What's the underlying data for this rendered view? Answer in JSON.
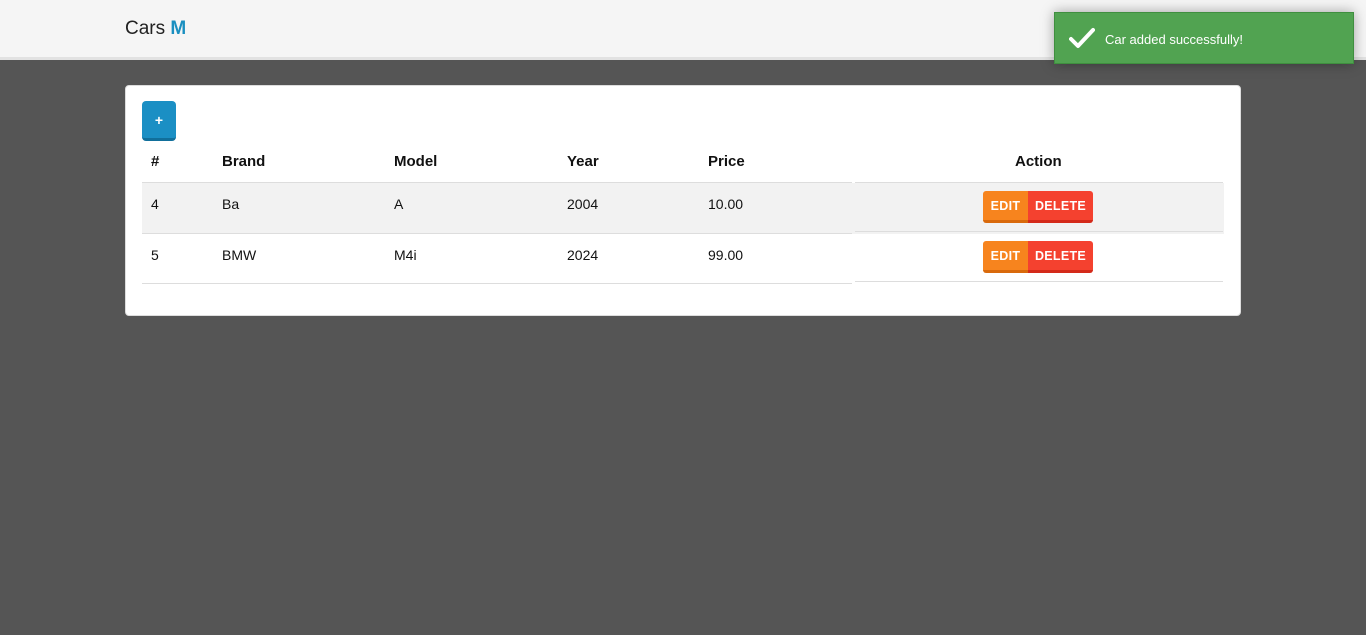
{
  "navbar": {
    "brand_text": "Cars",
    "brand_accent": "M"
  },
  "toast": {
    "message": "Car added successfully!",
    "icon": "check-icon"
  },
  "toolbar": {
    "add_label": "+"
  },
  "table": {
    "headers": [
      "#",
      "Brand",
      "Model",
      "Year",
      "Price",
      "Action"
    ],
    "rows": [
      {
        "id": "4",
        "brand": "Ba",
        "model": "A",
        "year": "2004",
        "price": "10.00"
      },
      {
        "id": "5",
        "brand": "BMW",
        "model": "M4i",
        "year": "2024",
        "price": "99.00"
      }
    ],
    "edit_label": "EDIT",
    "delete_label": "DELETE"
  },
  "colors": {
    "accent": "#1a8fc0",
    "toast": "#51a351",
    "edit": "#f7841e",
    "delete": "#f4412f"
  }
}
